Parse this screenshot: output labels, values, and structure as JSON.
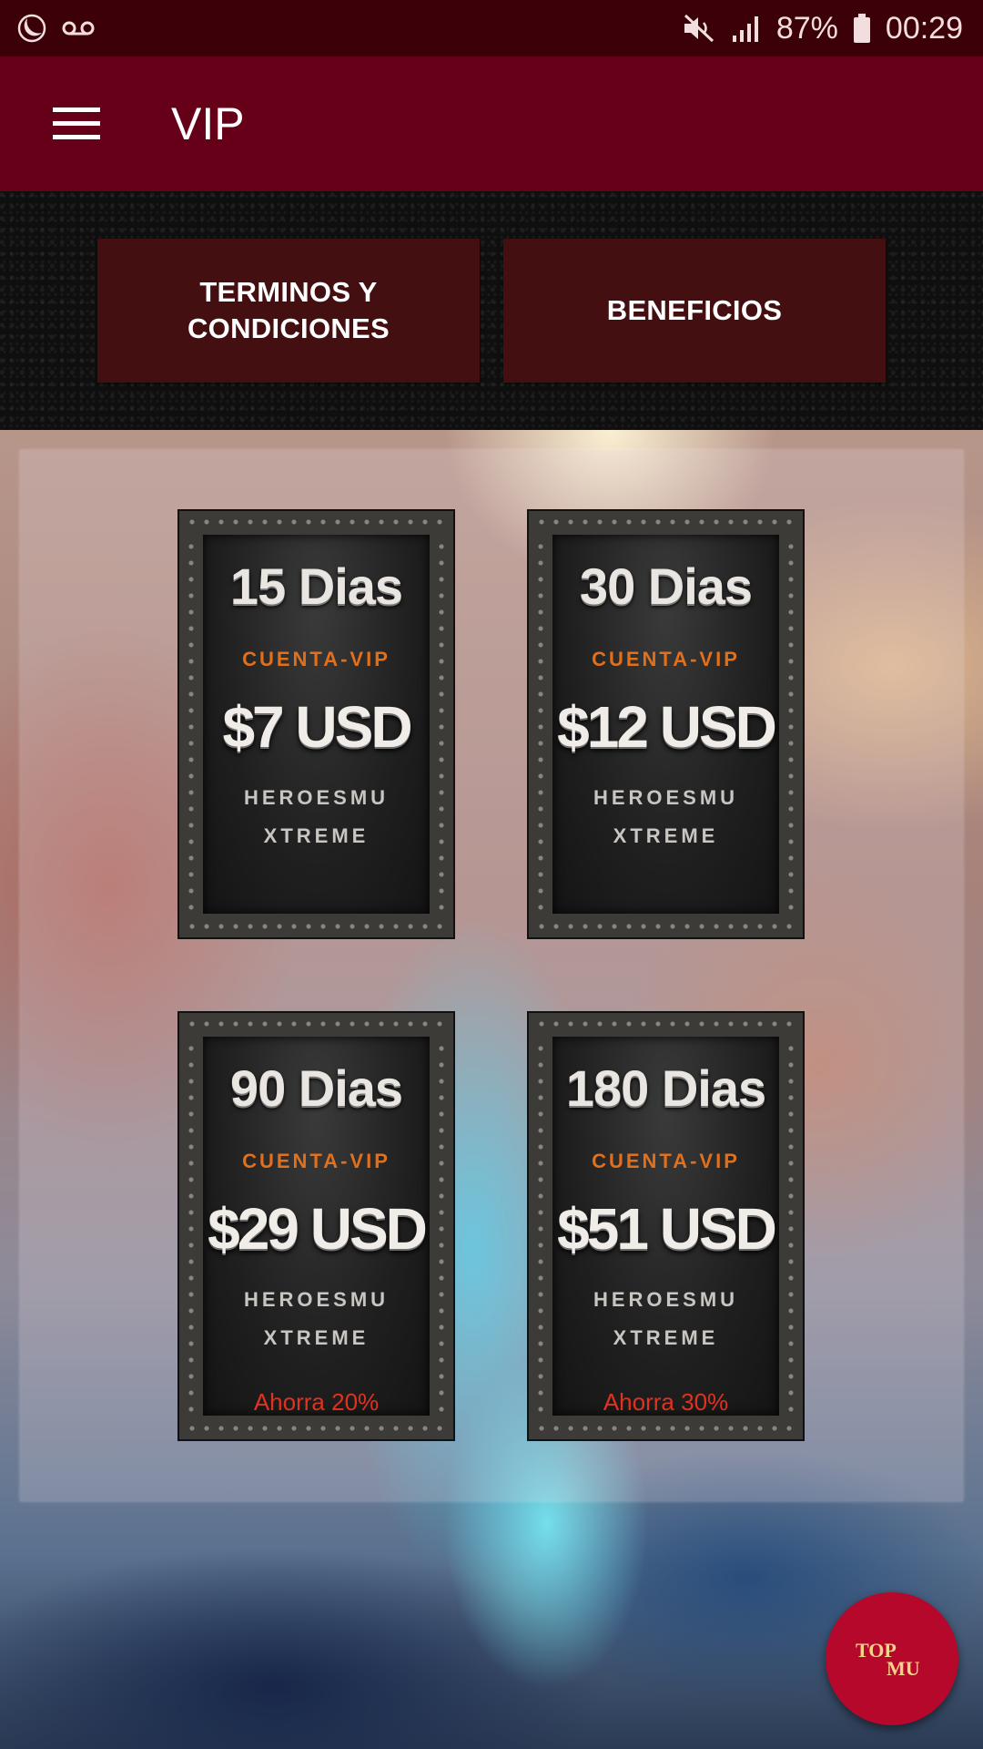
{
  "status_bar": {
    "battery_percent": "87%",
    "time": "00:29",
    "icons": [
      "moon-icon",
      "voicemail-icon",
      "mute-icon",
      "signal-icon",
      "battery-icon"
    ]
  },
  "app_bar": {
    "title": "VIP",
    "menu_icon": "hamburger-menu-icon"
  },
  "top_buttons": {
    "terms_line1": "TERMINOS Y",
    "terms_line2": "CONDICIONES",
    "benefits": "BENEFICIOS"
  },
  "plans": [
    {
      "days": "15 Dias",
      "type": "CUENTA-VIP",
      "price": "$7 USD",
      "brand_line1": "HEROESMU",
      "brand_line2": "XTREME",
      "savings": ""
    },
    {
      "days": "30 Dias",
      "type": "CUENTA-VIP",
      "price": "$12 USD",
      "brand_line1": "HEROESMU",
      "brand_line2": "XTREME",
      "savings": ""
    },
    {
      "days": "90 Dias",
      "type": "CUENTA-VIP",
      "price": "$29 USD",
      "brand_line1": "HEROESMU",
      "brand_line2": "XTREME",
      "savings": "Ahorra 20%"
    },
    {
      "days": "180 Dias",
      "type": "CUENTA-VIP",
      "price": "$51 USD",
      "brand_line1": "HEROESMU",
      "brand_line2": "XTREME",
      "savings": "Ahorra 30%"
    }
  ],
  "fab": {
    "logo_top": "TOP",
    "logo_bottom": "MU"
  },
  "colors": {
    "status_bar_bg": "#3c0008",
    "app_bar_bg": "#650018",
    "button_bg": "#440f10",
    "fab_bg": "#b5082a",
    "accent_orange": "#e0701c",
    "savings_red": "#e0321e"
  }
}
